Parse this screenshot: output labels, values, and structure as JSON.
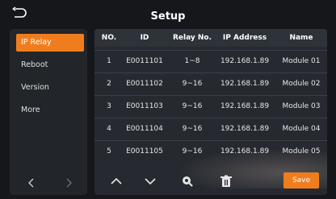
{
  "header": {
    "title": "Setup"
  },
  "sidebar": {
    "items": [
      {
        "label": "IP Relay",
        "active": true
      },
      {
        "label": "Reboot",
        "active": false
      },
      {
        "label": "Version",
        "active": false
      },
      {
        "label": "More",
        "active": false
      }
    ]
  },
  "table": {
    "headers": {
      "no": "NO.",
      "id": "ID",
      "relay": "Relay No.",
      "ip": "IP Address",
      "name": "Name"
    },
    "rows": [
      {
        "no": "1",
        "id": "E0011101",
        "relay": "1~8",
        "ip": "192.168.1.89",
        "name": "Module 01"
      },
      {
        "no": "2",
        "id": "E0011102",
        "relay": "9~16",
        "ip": "192.168.1.89",
        "name": "Module 02"
      },
      {
        "no": "3",
        "id": "E0011103",
        "relay": "9~16",
        "ip": "192.168.1.89",
        "name": "Module 03"
      },
      {
        "no": "4",
        "id": "E0011104",
        "relay": "9~16",
        "ip": "192.168.1.89",
        "name": "Module 04"
      },
      {
        "no": "5",
        "id": "E0011105",
        "relay": "9~16",
        "ip": "192.168.1.89",
        "name": "Module 05"
      }
    ]
  },
  "toolbar": {
    "save_label": "Save"
  },
  "colors": {
    "accent": "#f07d1d",
    "background": "#15171b",
    "panel": "#262a30"
  }
}
